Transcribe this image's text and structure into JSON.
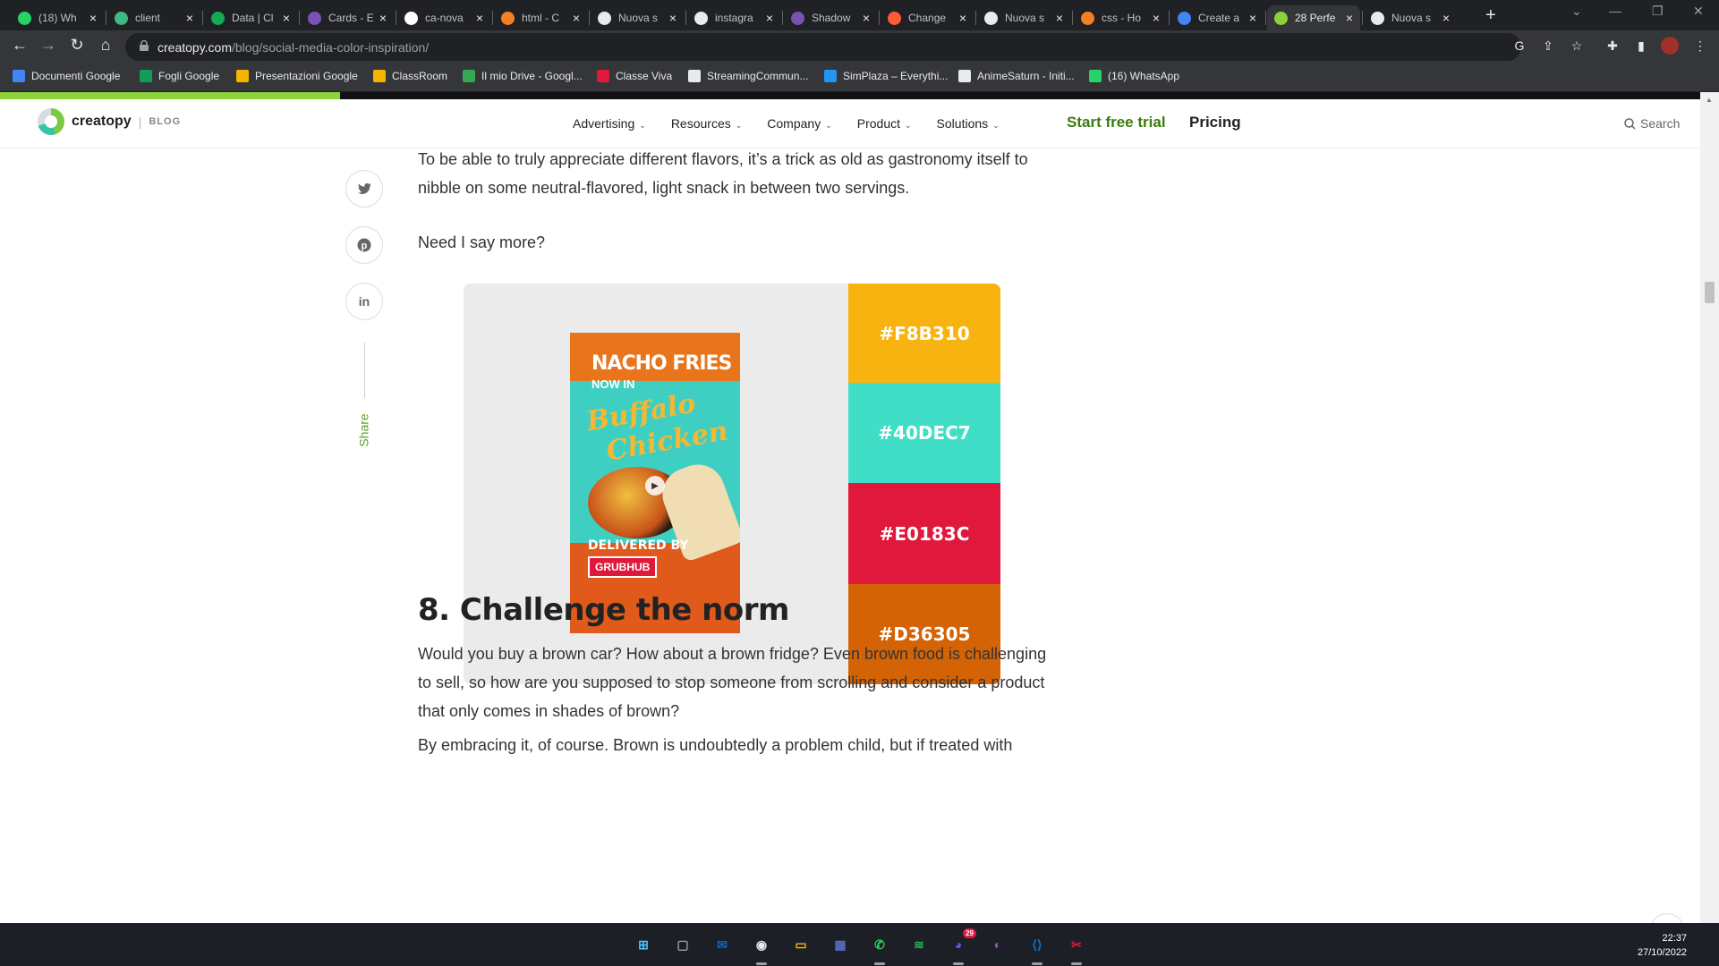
{
  "browser": {
    "tabs": [
      {
        "title": "(18) Wh",
        "icon": "whatsapp-icon",
        "color": "#25d366"
      },
      {
        "title": "client",
        "icon": "vue-icon",
        "color": "#41b883"
      },
      {
        "title": "Data | Cl",
        "icon": "mongodb-icon",
        "color": "#13aa52"
      },
      {
        "title": "Cards - E",
        "icon": "bootstrap-icon",
        "color": "#7952b3"
      },
      {
        "title": "ca-nova",
        "icon": "github-icon",
        "color": "#ffffff"
      },
      {
        "title": "html - C",
        "icon": "stackoverflow-icon",
        "color": "#f48024"
      },
      {
        "title": "Nuova s",
        "icon": "chrome-icon",
        "color": "#e8eaed"
      },
      {
        "title": "instagra",
        "icon": "google-icon",
        "color": "#e8eaed"
      },
      {
        "title": "Shadow",
        "icon": "bootstrap-icon",
        "color": "#7952b3"
      },
      {
        "title": "Change",
        "icon": "asterisk-icon",
        "color": "#ff5a36"
      },
      {
        "title": "Nuova s",
        "icon": "chrome-icon",
        "color": "#e8eaed"
      },
      {
        "title": "css - Ho",
        "icon": "stackoverflow-icon",
        "color": "#f48024"
      },
      {
        "title": "Create a",
        "icon": "chrome-blue-icon",
        "color": "#4285f4"
      },
      {
        "title": "28 Perfe",
        "icon": "creatopy-icon",
        "color": "#8bd23c"
      },
      {
        "title": "Nuova s",
        "icon": "chrome-icon",
        "color": "#e8eaed"
      }
    ],
    "url_domain": "creatopy.com",
    "url_path": "/blog/social-media-color-inspiration/",
    "bookmarks": [
      {
        "label": "Documenti Google",
        "color": "#4285f4"
      },
      {
        "label": "Fogli Google",
        "color": "#0f9d58"
      },
      {
        "label": "Presentazioni Google",
        "color": "#f4b400"
      },
      {
        "label": "ClassRoom",
        "color": "#f4b400"
      },
      {
        "label": "Il mio Drive - Googl...",
        "color": "#34a853"
      },
      {
        "label": "Classe Viva",
        "color": "#e0183c"
      },
      {
        "label": "StreamingCommun...",
        "color": "#e8eaed"
      },
      {
        "label": "SimPlaza – Everythi...",
        "color": "#2196f3"
      },
      {
        "label": "AnimeSaturn - Initi...",
        "color": "#e8eaed"
      },
      {
        "label": "(16) WhatsApp",
        "color": "#25d366"
      }
    ]
  },
  "site": {
    "logo": "creatopy",
    "logo_suffix": "BLOG",
    "nav": [
      "Advertising",
      "Resources",
      "Company",
      "Product",
      "Solutions"
    ],
    "cta": "Start free trial",
    "pricing": "Pricing",
    "search": "Search",
    "reading_progress": 0.2,
    "accent": "#3a7d0c"
  },
  "share": {
    "label": "Share",
    "buttons": [
      "twitter-icon",
      "pinterest-icon",
      "linkedin-icon"
    ]
  },
  "article": {
    "p1": "To be able to truly appreciate different flavors, it’s a trick as old as gastronomy itself to nibble on some neutral-flavored, light snack in between two servings.",
    "p2": "Need I say more?",
    "heading": "8. Challenge the norm",
    "p3": "Would you buy a brown car? How about a brown fridge? Even brown food is challenging to sell, so how are you supposed to stop someone from scrolling and consider a product that only comes in shades of brown?",
    "p4": "By embracing it, of course. Brown is undoubtedly a problem child, but if treated with"
  },
  "image": {
    "poster_line1": "NACHO FRIES",
    "poster_line2": "NOW IN",
    "poster_line3": "Buffalo",
    "poster_line4": "Chicken",
    "poster_delivered": "DELIVERED BY",
    "poster_brand": "GRUBHUB",
    "swatches": [
      {
        "hex": "#F8B310",
        "color": "#F8B310"
      },
      {
        "hex": "#40DEC7",
        "color": "#40DEC7"
      },
      {
        "hex": "#E0183C",
        "color": "#E0183C"
      },
      {
        "hex": "#D36305",
        "color": "#D36305"
      }
    ]
  },
  "taskbar": {
    "time": "22:37",
    "date": "27/10/2022",
    "apps": [
      "windows-start-icon",
      "task-view-icon",
      "mail-icon",
      "chrome-icon",
      "file-explorer-icon",
      "store-icon",
      "whatsapp-icon",
      "spotify-icon",
      "discord-icon",
      "github-desktop-icon",
      "vscode-icon",
      "snipping-tool-icon"
    ],
    "discord_badge": "29"
  }
}
